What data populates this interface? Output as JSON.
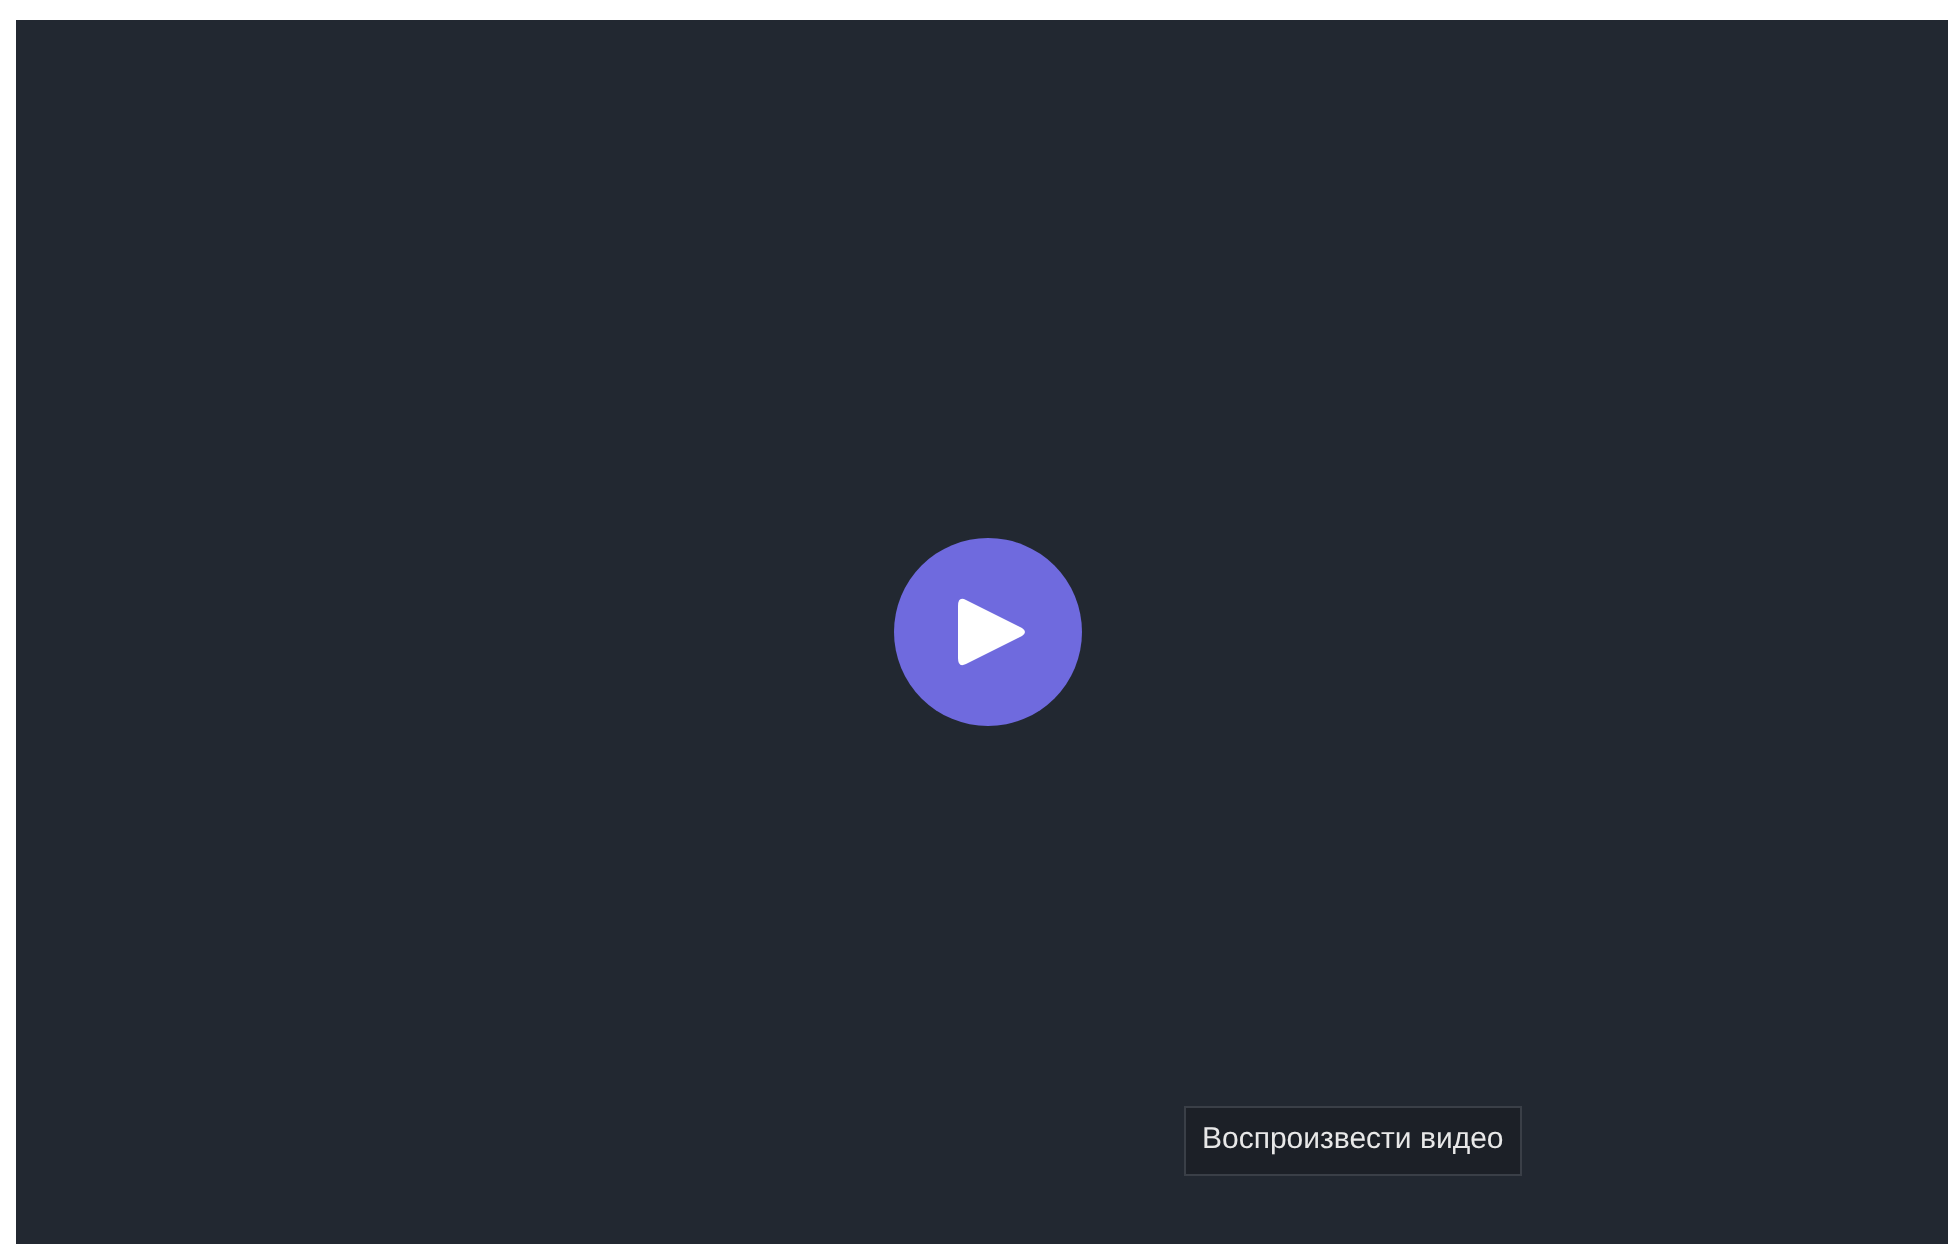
{
  "player": {
    "play_button": {
      "tooltip": "Воспроизвести видео"
    }
  }
}
